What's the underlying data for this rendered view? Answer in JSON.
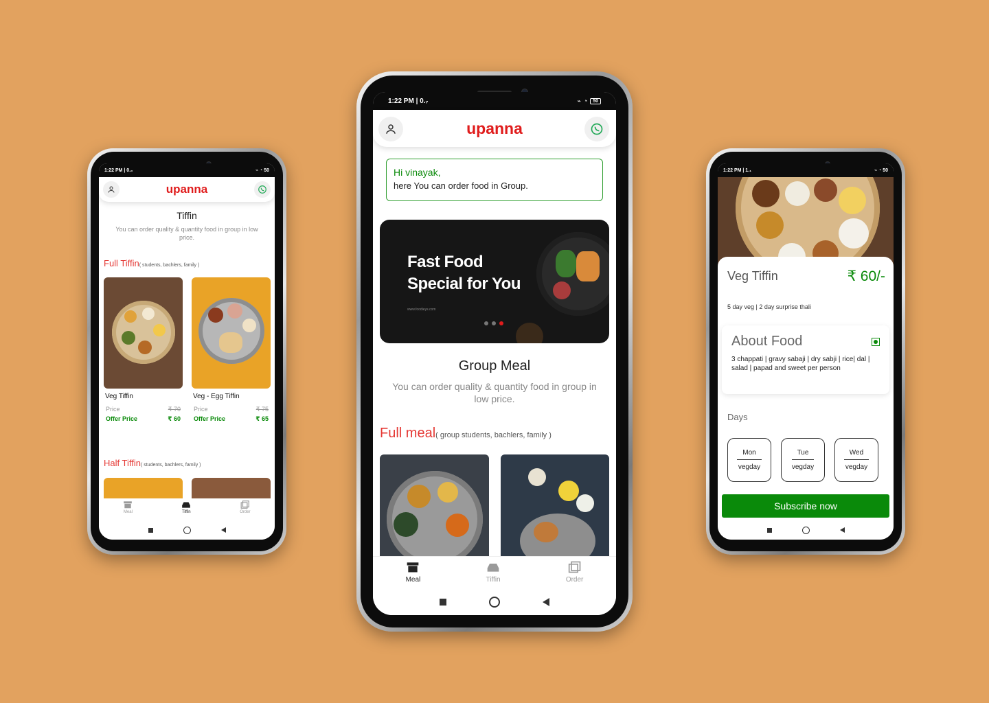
{
  "colors": {
    "background": "#E2A25F",
    "brand": "#E01C1C",
    "green": "#0A8A0A",
    "dark_card": "#161616"
  },
  "status": {
    "time_center": "1:22 PM | 0.₇",
    "time_left": "1:22 PM | 0.₀",
    "time_right": "1:22 PM | 1.₁",
    "battery": "50"
  },
  "app": {
    "brand": "upanna"
  },
  "left": {
    "title": "Tiffin",
    "subtitle": "You can order quality & quantity food in group in low price.",
    "full_section": "Full Tiffin",
    "full_section_note": "( students, bachlers, family )",
    "half_section": "Half Tiffin",
    "half_section_note": "( students, bachlers, family )",
    "cards": [
      {
        "name": "Veg Tiffin",
        "price_label": "Price",
        "price": "₹ 70",
        "offer_label": "Offer Price",
        "offer": "₹ 60"
      },
      {
        "name": "Veg - Egg Tiffin",
        "price_label": "Price",
        "price": "₹ 75",
        "offer_label": "Offer Price",
        "offer": "₹ 65"
      }
    ],
    "nav": [
      "Meal",
      "Tiffin",
      "Order"
    ]
  },
  "center": {
    "greeting": "Hi vinayak,",
    "greeting_line2": "here You can order food in Group.",
    "banner_title_1": "Fast Food",
    "banner_title_2": "Special for You",
    "banner_url": "www.foodieys.com",
    "section_title": "Group Meal",
    "section_subtitle": "You can order quality & quantity food in group in low price.",
    "full_meal": "Full meal",
    "full_meal_note": "( group students, bachlers, family )",
    "nav": [
      "Meal",
      "Tiffin",
      "Order"
    ]
  },
  "right": {
    "title": "Veg Tiffin",
    "price": "₹ 60/-",
    "schedule": "5 day veg | 2 day surprise thali",
    "about_title": "About Food",
    "about_text": "3 chappati | gravy sabaji | dry sabji | rice| dal | salad | papad and sweet per person",
    "days_label": "Days",
    "days": [
      {
        "day": "Mon",
        "type": "vegday"
      },
      {
        "day": "Tue",
        "type": "vegday"
      },
      {
        "day": "Wed",
        "type": "vegday"
      }
    ],
    "subscribe": "Subscribe now"
  }
}
